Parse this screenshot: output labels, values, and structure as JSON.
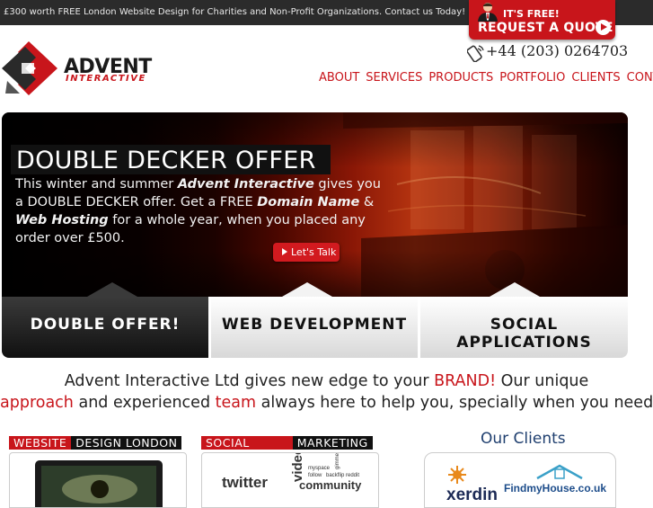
{
  "topbar": {
    "promo": "£300 worth FREE London Website Design for Charities and Non-Profit Organizations. Contact us Today!"
  },
  "quote": {
    "small": "IT'S FREE!",
    "main": "REQUEST A QUOTE"
  },
  "logo": {
    "name": "ADVENT",
    "sub": "INTERACTIVE"
  },
  "phone": "+44 (203) 0264703",
  "nav": {
    "items": [
      "ABOUT",
      "SERVICES",
      "PRODUCTS",
      "PORTFOLIO",
      "CLIENTS",
      "CONTACT"
    ]
  },
  "hero": {
    "title": "DOUBLE DECKER OFFER",
    "line1_pre": "This winter and summer ",
    "line1_brand": "Advent Interactive",
    "line1_post": " gives you",
    "line2_pre": "a DOUBLE DECKER offer. Get a FREE ",
    "line2_domain": "Domain Name",
    "line2_post": " &",
    "line3_hosting": "Web Hosting",
    "line3_post": " for a whole year, when you placed any",
    "line4": "order over £500.",
    "cta": "Let's Talk"
  },
  "tabs": [
    "DOUBLE OFFER!",
    "WEB DEVELOPMENT",
    "SOCIAL APPLICATIONS"
  ],
  "tagline": {
    "p1": "Advent Interactive Ltd gives new edge to your ",
    "brand": "BRAND!",
    "p2": " Our unique",
    "approach": "approach",
    "p3": " and experienced ",
    "team": "team",
    "p4": " always here to help you, specially when you need!"
  },
  "columns": {
    "website_red": "WEBSITE",
    "website_dark": "DESIGN LONDON",
    "social_red": "SOCIAL",
    "social_dark": "MARKETING",
    "clients_title": "Our Clients",
    "social_words": [
      "twitter",
      "video",
      "myspace",
      "follow",
      "backflip",
      "gimme",
      "reddit",
      "community"
    ],
    "client_logos": [
      "xerdin",
      "FindmyHouse.co.uk"
    ]
  },
  "colors": {
    "accent": "#c8151b",
    "dark": "#111111",
    "clients_title": "#1f3f6f"
  }
}
